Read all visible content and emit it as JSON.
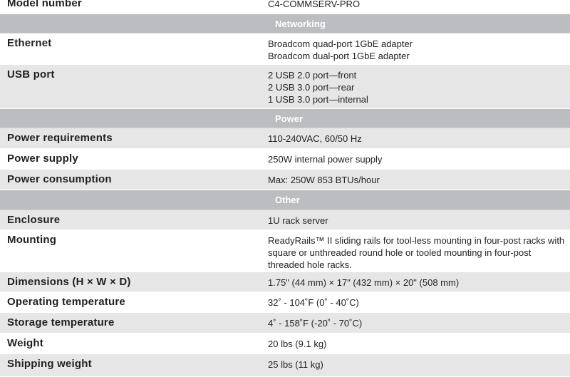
{
  "spec_table": {
    "rows": [
      {
        "type": "spec",
        "label": "Model number",
        "values": [
          "C4-COMMSERV-PRO"
        ]
      },
      {
        "type": "section",
        "title": "Networking"
      },
      {
        "type": "spec",
        "label": "Ethernet",
        "values": [
          "Broadcom quad-port 1GbE adapter",
          "Broadcom dual-port 1GbE adapter"
        ]
      },
      {
        "type": "spec",
        "label": "USB port",
        "values": [
          "2 USB 2.0 port—front",
          "2 USB 3.0 port—rear",
          "1 USB 3.0 port—internal"
        ]
      },
      {
        "type": "section",
        "title": "Power"
      },
      {
        "type": "spec",
        "label": "Power requirements",
        "values": [
          "110-240VAC, 60/50 Hz"
        ]
      },
      {
        "type": "spec",
        "label": "Power supply",
        "values": [
          "250W internal power supply"
        ]
      },
      {
        "type": "spec",
        "label": "Power consumption",
        "values": [
          "Max: 250W 853 BTUs/hour"
        ]
      },
      {
        "type": "section",
        "title": "Other"
      },
      {
        "type": "spec",
        "label": "Enclosure",
        "values": [
          "1U rack server"
        ]
      },
      {
        "type": "spec",
        "label": "Mounting",
        "values": [
          "ReadyRails™ II sliding rails for tool-less mounting in four-post racks with square or unthreaded round hole or tooled mounting in four-post threaded hole racks."
        ]
      },
      {
        "type": "spec",
        "label": "Dimensions (H × W × D)",
        "values": [
          "1.75\" (44 mm) × 17\" (432 mm) × 20\" (508 mm)"
        ]
      },
      {
        "type": "spec",
        "label": "Operating temperature",
        "values": [
          "32˚ - 104˚F (0˚ - 40˚C)"
        ]
      },
      {
        "type": "spec",
        "label": "Storage temperature",
        "values": [
          "4˚ - 158˚F (-20˚ - 70˚C)"
        ]
      },
      {
        "type": "spec",
        "label": "Weight",
        "values": [
          "20 lbs (9.1 kg)"
        ]
      },
      {
        "type": "spec",
        "label": "Shipping weight",
        "values": [
          "25 lbs (11 kg)"
        ]
      }
    ]
  }
}
